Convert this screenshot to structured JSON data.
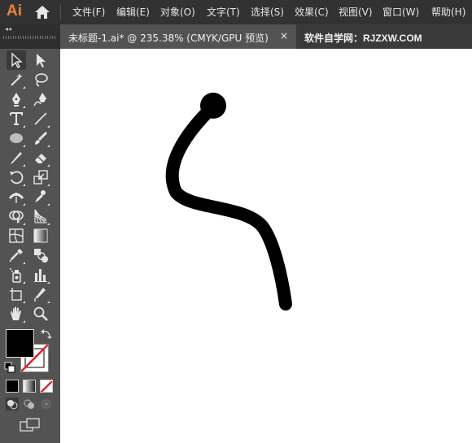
{
  "app": {
    "logo": "Ai"
  },
  "menu": {
    "items": [
      "文件(F)",
      "编辑(E)",
      "对象(O)",
      "文字(T)",
      "选择(S)",
      "效果(C)",
      "视图(V)",
      "窗口(W)",
      "帮助(H)"
    ]
  },
  "document": {
    "tab_title": "未标题-1.ai* @ 235.38% (CMYK/GPU 预览)",
    "close_label": "×"
  },
  "watermark": {
    "site_label": "软件自学网：RJZXW.COM"
  },
  "toolbar": {
    "collapse_label": "◂◂",
    "tools": [
      "selection-tool-icon",
      "direct-selection-tool-icon",
      "magic-wand-tool-icon",
      "lasso-tool-icon",
      "pen-tool-icon",
      "curvature-tool-icon",
      "type-tool-icon",
      "line-segment-tool-icon",
      "ellipse-tool-icon",
      "paintbrush-tool-icon",
      "pencil-tool-icon",
      "eraser-tool-icon",
      "rotate-tool-icon",
      "scale-tool-icon",
      "width-tool-icon",
      "puppet-warp-tool-icon",
      "shape-builder-tool-icon",
      "perspective-grid-tool-icon",
      "mesh-tool-icon",
      "gradient-tool-icon",
      "eyedropper-tool-icon",
      "blend-tool-icon",
      "symbol-sprayer-tool-icon",
      "column-graph-tool-icon",
      "artboard-tool-icon",
      "slice-tool-icon",
      "hand-tool-icon",
      "zoom-tool-icon"
    ],
    "active_tool": "selection-tool-icon"
  },
  "colors": {
    "fill": "#000000",
    "stroke": "#ffffff",
    "menubar_bg": "#323232",
    "panel_bg": "#535353",
    "accent_logo": "#e8833a"
  }
}
